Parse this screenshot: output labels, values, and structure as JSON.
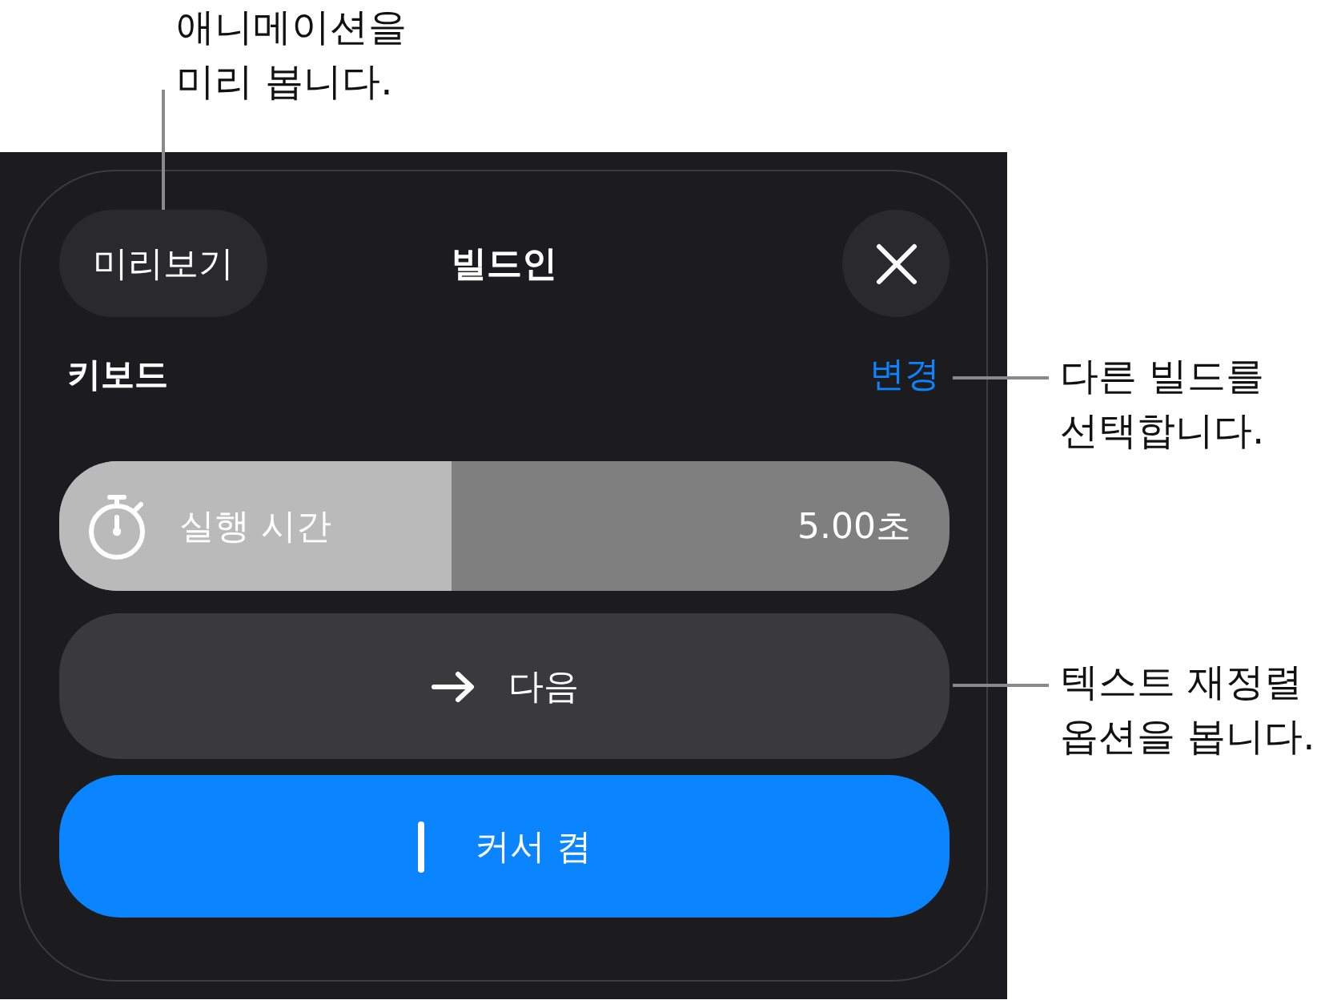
{
  "annotations": [
    {
      "text": "애니메이션을\n미리 봅니다."
    },
    {
      "text": "다른 빌드를\n선택합니다."
    },
    {
      "text": "텍스트 재정렬\n옵션을 봅니다."
    }
  ],
  "header": {
    "preview_button": "미리보기",
    "title": "빌드인"
  },
  "build": {
    "name": "키보드",
    "change_link": "변경"
  },
  "duration": {
    "label": "실행 시간",
    "value": "5.00초",
    "level": 0.44
  },
  "options": [
    {
      "kind": "direction",
      "label": "다음",
      "on": false
    },
    {
      "kind": "cursor",
      "label": "커서 켬",
      "on": true
    }
  ]
}
